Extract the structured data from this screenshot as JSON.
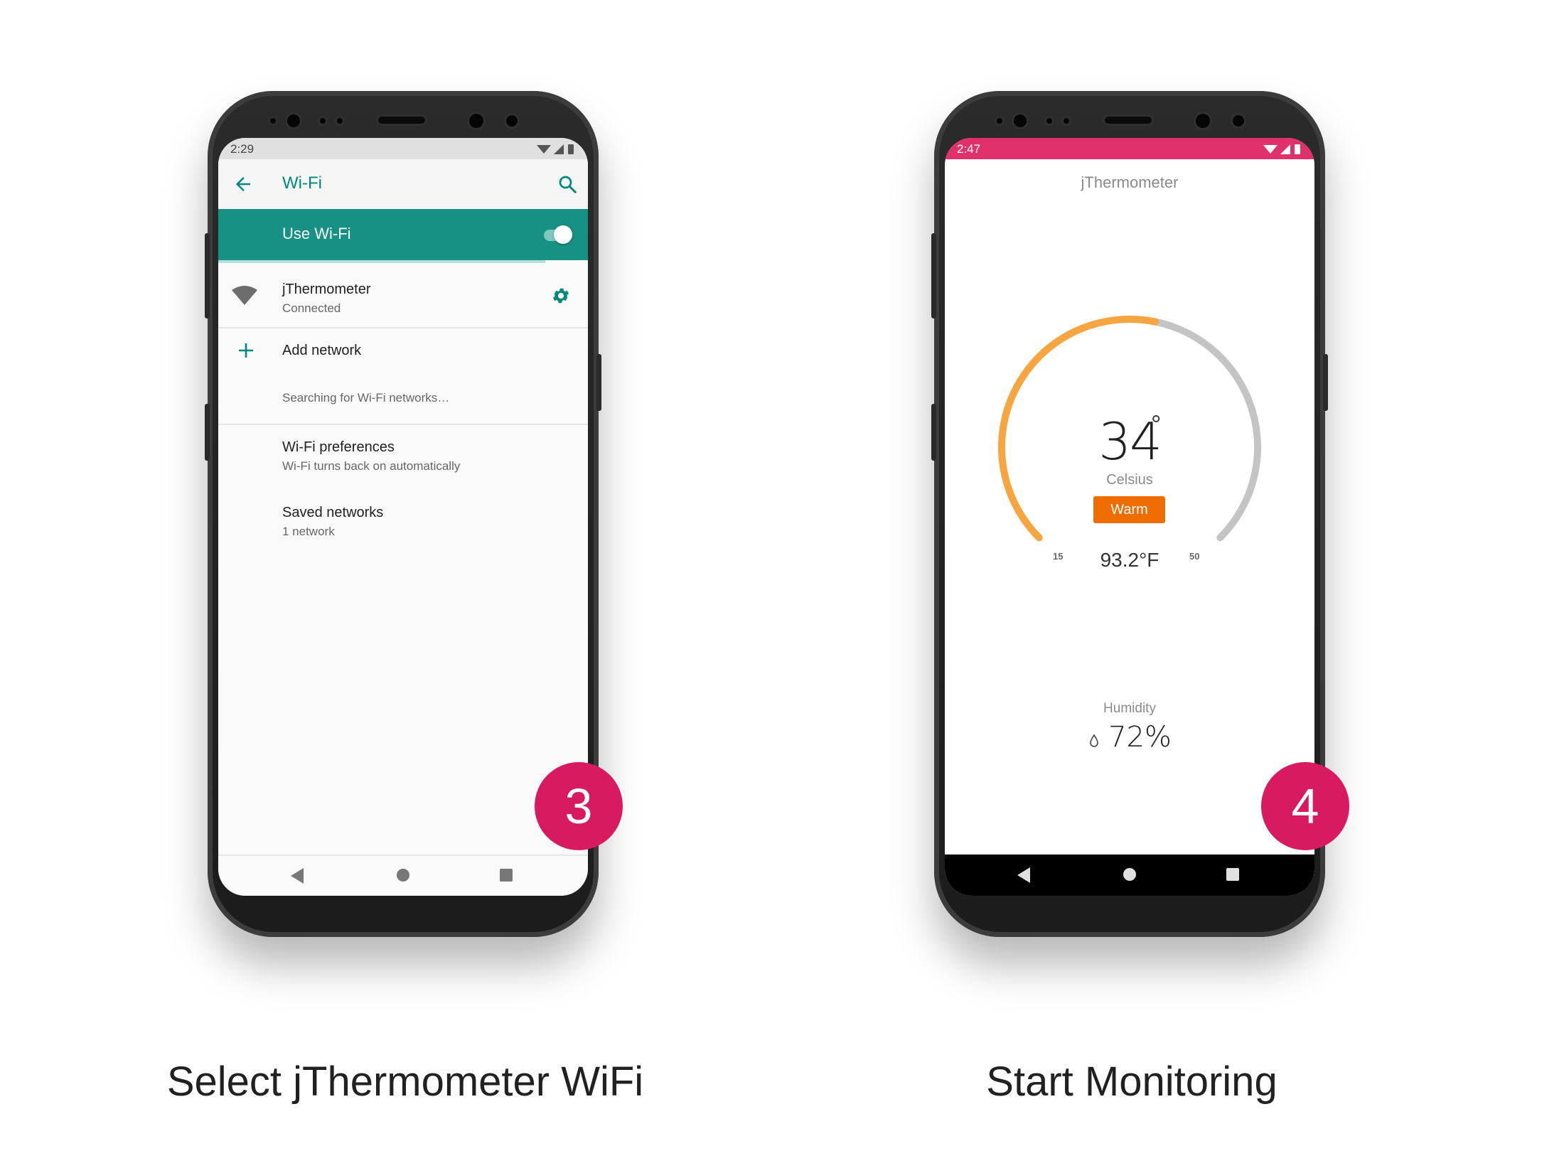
{
  "step3": {
    "status_time": "2:29",
    "appbar_title": "Wi-Fi",
    "use_wifi_label": "Use Wi-Fi",
    "network_name": "jThermometer",
    "network_status": "Connected",
    "add_network": "Add network",
    "searching": "Searching for Wi-Fi networks…",
    "prefs_title": "Wi-Fi preferences",
    "prefs_sub": "Wi-Fi turns back on automatically",
    "saved_title": "Saved networks",
    "saved_sub": "1 network",
    "badge": "3",
    "caption": "Select jThermometer WiFi",
    "toggle_on": true
  },
  "step4": {
    "status_time": "2:47",
    "app_title": "jThermometer",
    "temperature": "34",
    "degree_symbol": "°",
    "unit": "Celsius",
    "status": "Warm",
    "scale_min": "15",
    "scale_max": "50",
    "temperature_value": 34,
    "gauge_min": 15,
    "gauge_max": 50,
    "fahrenheit": "93.2°F",
    "humidity_label": "Humidity",
    "humidity_value": "72%",
    "badge": "4",
    "caption": "Start Monitoring"
  },
  "colors": {
    "teal": "#00897b",
    "teal_bar": "#179184",
    "pink": "#e0316d",
    "badge": "#d81b60",
    "gauge_active": "#f7a540",
    "gauge_inactive": "#c4c4c4",
    "warm_badge": "#ef6c00"
  }
}
